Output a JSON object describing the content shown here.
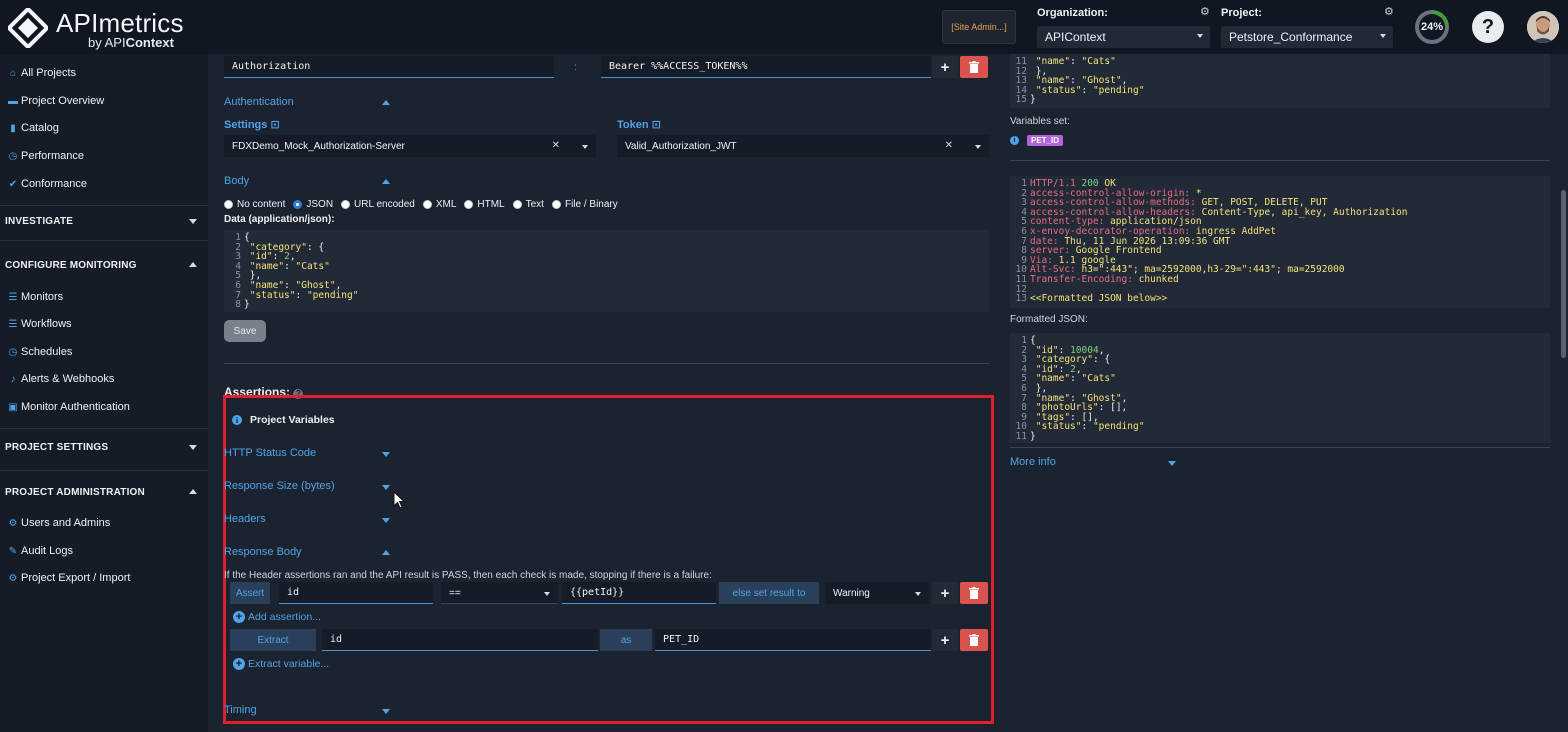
{
  "header": {
    "logo_title": "APImetrics",
    "logo_by": "by API",
    "logo_brand": "Context",
    "site_admin": "[Site Admin...]",
    "org_label": "Organization:",
    "org_value": "APIContext",
    "project_label": "Project:",
    "project_value": "Petstore_Conformance",
    "progress_label": "24%",
    "progress_fraction": 0.24,
    "help_label": "?"
  },
  "sidebar": {
    "top_items": [
      {
        "label": "All Projects",
        "icon": "home-icon"
      },
      {
        "label": "Project Overview",
        "icon": "folder-icon"
      },
      {
        "label": "Catalog",
        "icon": "book-icon"
      },
      {
        "label": "Performance",
        "icon": "gauge-icon"
      },
      {
        "label": "Conformance",
        "icon": "check-icon"
      }
    ],
    "investigate": "INVESTIGATE",
    "configure_monitoring": "CONFIGURE MONITORING",
    "monitoring_items": [
      {
        "label": "Monitors",
        "icon": "list-icon"
      },
      {
        "label": "Workflows",
        "icon": "list-icon"
      },
      {
        "label": "Schedules",
        "icon": "clock-icon"
      },
      {
        "label": "Alerts & Webhooks",
        "icon": "bell-icon"
      },
      {
        "label": "Monitor Authentication",
        "icon": "lock-icon"
      }
    ],
    "project_settings": "PROJECT SETTINGS",
    "project_administration": "PROJECT ADMINISTRATION",
    "admin_items": [
      {
        "label": "Users and Admins",
        "icon": "gear-icon"
      },
      {
        "label": "Audit Logs",
        "icon": "edit-icon"
      },
      {
        "label": "Project Export / Import",
        "icon": "gear-icon"
      }
    ]
  },
  "request": {
    "header_key": "Authorization",
    "header_sep": ":",
    "header_value": "Bearer %%ACCESS_TOKEN%%",
    "authentication": "Authentication",
    "settings_label": "Settings",
    "settings_value": "FDXDemo_Mock_Authorization-Server",
    "token_label": "Token",
    "token_value": "Valid_Authorization_JWT",
    "body_label": "Body",
    "body_options": [
      "No content",
      "JSON",
      "URL encoded",
      "XML",
      "HTML",
      "Text",
      "File / Binary"
    ],
    "body_selected": "JSON",
    "data_label": "Data (application/json):",
    "body_code": [
      "{",
      "  \"category\": {",
      "    \"id\": 2,",
      "    \"name\": \"Cats\"",
      "  },",
      "  \"name\": \"Ghost\",",
      "  \"status\": \"pending\"",
      "}"
    ],
    "save_label": "Save"
  },
  "assertions": {
    "title": "Assertions:",
    "project_variables": "Project Variables",
    "sections": [
      "HTTP Status Code",
      "Response Size (bytes)",
      "Headers",
      "Response Body",
      "Timing"
    ],
    "description": "If the Header assertions ran and the API result is PASS, then each check is made, stopping if there is a failure:",
    "assert_label": "Assert",
    "assert_field": "id",
    "assert_op": "==",
    "assert_value": "{{petId}}",
    "else_label": "else set result to",
    "else_value": "Warning",
    "add_assertion": "Add assertion...",
    "extract_label": "Extract",
    "extract_field": "id",
    "as_label": "as",
    "extract_var": "PET_ID",
    "extract_variable": "Extract variable..."
  },
  "right_panel": {
    "top_code": [
      {
        "n": "11",
        "t": "    \"name\": \"Cats\""
      },
      {
        "n": "12",
        "t": "  },"
      },
      {
        "n": "13",
        "t": "  \"name\": \"Ghost\","
      },
      {
        "n": "14",
        "t": "  \"status\": \"pending\""
      },
      {
        "n": "15",
        "t": "}"
      }
    ],
    "variables_set": "Variables set:",
    "variable_badge": "PET_ID",
    "response_headers": [
      {
        "n": "1",
        "k": "HTTP/1.1 ",
        "v": "200",
        "r": " OK"
      },
      {
        "n": "2",
        "k": "access-control-allow-origin:",
        "r": " *"
      },
      {
        "n": "3",
        "k": "access-control-allow-methods:",
        "r": " GET, POST, DELETE, PUT"
      },
      {
        "n": "4",
        "k": "access-control-allow-headers:",
        "r": " Content-Type, api_key, Authorization"
      },
      {
        "n": "5",
        "k": "content-type:",
        "r": " application/json"
      },
      {
        "n": "6",
        "k": "x-envoy-decorator-operation:",
        "r": " ingress AddPet"
      },
      {
        "n": "7",
        "k": "date:",
        "r": " Thu, 11 Jun 2026 13:09:36 GMT"
      },
      {
        "n": "8",
        "k": "server:",
        "r": " Google Frontend"
      },
      {
        "n": "9",
        "k": "Via:",
        "r": " 1.1 google"
      },
      {
        "n": "10",
        "k": "Alt-Svc:",
        "r": " h3=\":443\"; ma=2592000,h3-29=\":443\"; ma=2592000"
      },
      {
        "n": "11",
        "k": "Transfer-Encoding:",
        "r": " chunked"
      },
      {
        "n": "12",
        "k": "",
        "r": ""
      },
      {
        "n": "13",
        "k": "",
        "r": "<<Formatted JSON below>>"
      }
    ],
    "formatted_label": "Formatted JSON:",
    "formatted_code": [
      {
        "n": "1",
        "t": "{"
      },
      {
        "n": "2",
        "t": "  \"id\": 10004,"
      },
      {
        "n": "3",
        "t": "  \"category\": {"
      },
      {
        "n": "4",
        "t": "    \"id\": 2,"
      },
      {
        "n": "5",
        "t": "    \"name\": \"Cats\""
      },
      {
        "n": "6",
        "t": "  },"
      },
      {
        "n": "7",
        "t": "  \"name\": \"Ghost\","
      },
      {
        "n": "8",
        "t": "  \"photoUrls\": [],"
      },
      {
        "n": "9",
        "t": "  \"tags\": [],"
      },
      {
        "n": "10",
        "t": "  \"status\": \"pending\""
      },
      {
        "n": "11",
        "t": "}"
      }
    ],
    "more_info": "More info"
  },
  "colors": {
    "accent": "#4fa3e6",
    "highlight_box": "#e0202b",
    "danger": "#d9534f",
    "badge": "#b464d8"
  }
}
